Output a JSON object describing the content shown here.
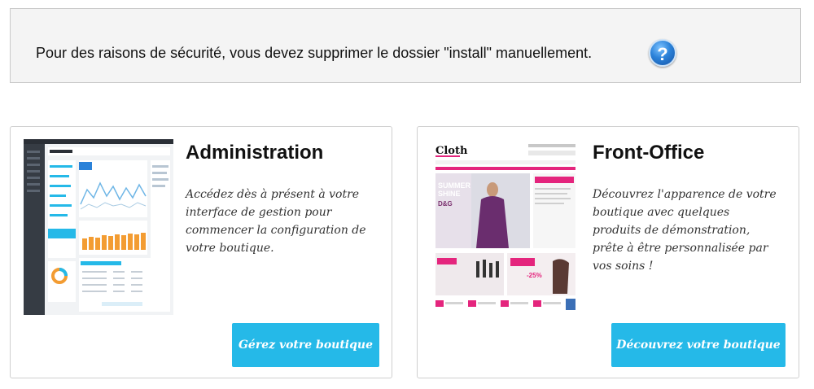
{
  "alert": {
    "message": "Pour des raisons de sécurité, vous devez supprimer le dossier \"install\" manuellement.",
    "help_icon_glyph": "?",
    "help_icon": "question-mark-icon"
  },
  "cards": [
    {
      "title": "Administration",
      "description": "Accédez dès à présent à votre interface de gestion pour commencer la configuration de votre boutique.",
      "button_label": "Gérez votre boutique",
      "thumbnail": "admin-dashboard-screenshot"
    },
    {
      "title": "Front-Office",
      "description": "Découvrez l'apparence de votre boutique avec quelques produits de démonstration, prête à être personnalisée par vos soins !",
      "button_label": "Découvrez votre boutique",
      "thumbnail": "storefront-screenshot"
    }
  ],
  "colors": {
    "button": "#25b9e8",
    "alert_bg": "#f4f4f4",
    "help_icon": "#2b82d9"
  }
}
